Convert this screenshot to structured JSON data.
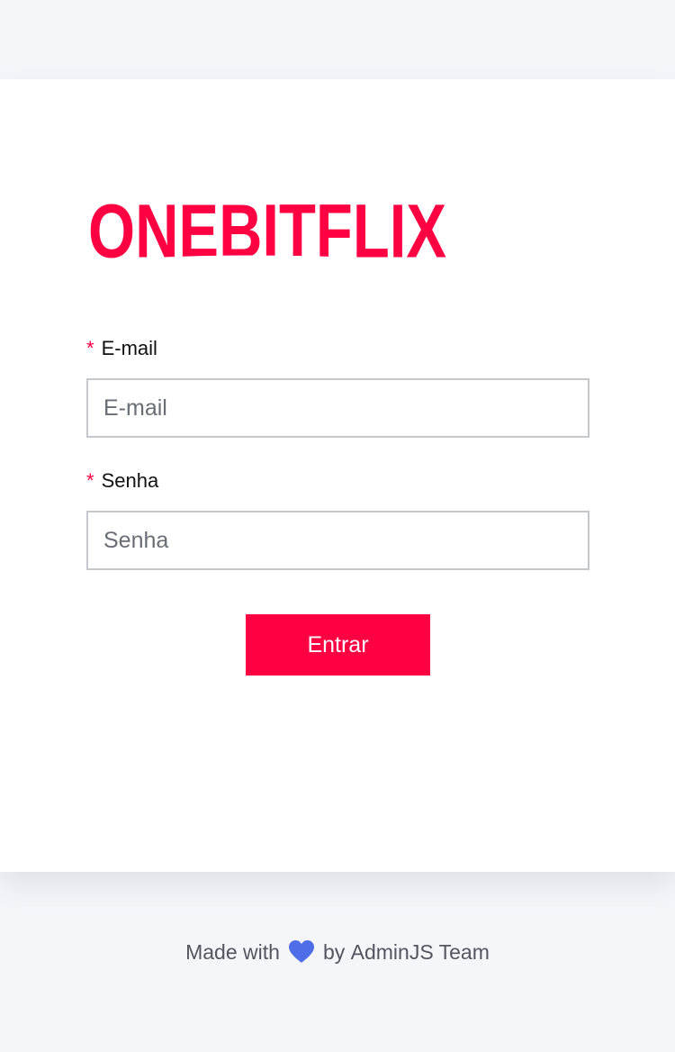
{
  "logo": {
    "text": "ONEBITFLIX",
    "color": "#ff0043"
  },
  "form": {
    "required_marker": "*",
    "email": {
      "label": "E-mail",
      "placeholder": "E-mail",
      "value": ""
    },
    "password": {
      "label": "Senha",
      "placeholder": "Senha",
      "value": ""
    },
    "submit_label": "Entrar"
  },
  "footer": {
    "made_with": "Made with",
    "heart_icon": "heart-icon",
    "heart_color": "#4f6de6",
    "by": "by",
    "team": "AdminJS Team"
  },
  "colors": {
    "accent": "#ff0043",
    "background": "#f5f6fa",
    "card": "#ffffff"
  }
}
